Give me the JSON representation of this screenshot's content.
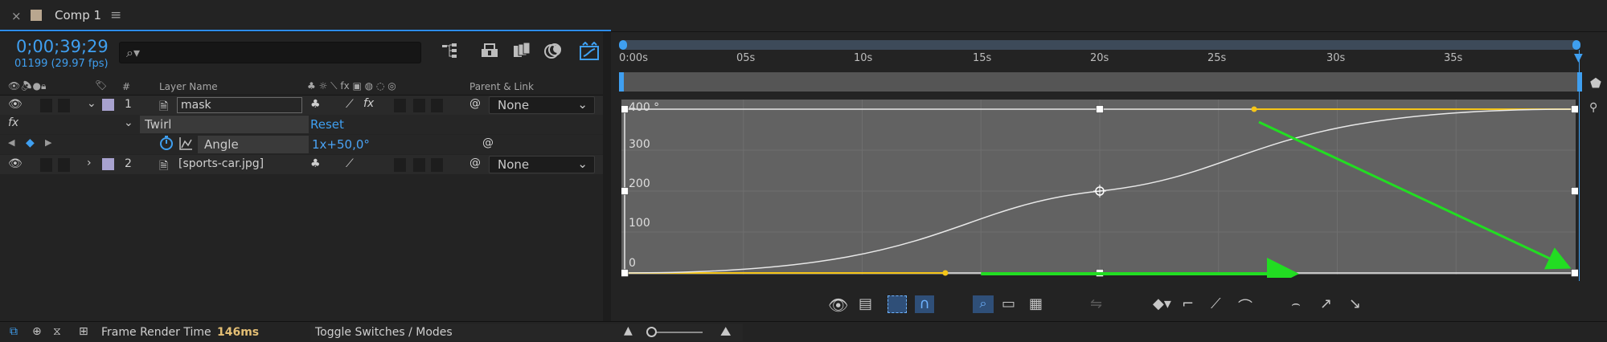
{
  "comp_tab": {
    "close": "×",
    "title": "Comp 1",
    "menu": "≡"
  },
  "timecode": "0;00;39;29",
  "fps": "01199 (29.97 fps)",
  "search": {
    "placeholder": "",
    "icon": "search-icon"
  },
  "layer_header": {
    "number_col": "#",
    "layer_name_col": "Layer Name",
    "parent_col": "Parent & Link"
  },
  "layers": [
    {
      "index": "1",
      "name": "mask",
      "parent": "None"
    },
    {
      "index": "2",
      "name": "[sports-car.jpg]",
      "parent": "None"
    }
  ],
  "effect": {
    "fx_label": "fx",
    "name": "Twirl",
    "reset_label": "Reset",
    "property_name": "Angle",
    "property_value": "1x+50,0°"
  },
  "ruler": {
    "start_label": "0:00s",
    "ticks": [
      "05s",
      "10s",
      "15s",
      "20s",
      "25s",
      "30s",
      "35s"
    ]
  },
  "graph": {
    "y_labels": [
      "400 °",
      "300",
      "200",
      "100",
      "0"
    ]
  },
  "bottom_bar": {
    "frame_render_label": "Frame Render Time",
    "frame_render_value": "146ms",
    "toggle_label": "Toggle Switches / Modes"
  },
  "chart_data": {
    "type": "line",
    "xlabel": "",
    "ylabel": "",
    "x_ticks": [
      "0:00s",
      "05s",
      "10s",
      "15s",
      "20s",
      "25s",
      "30s",
      "35s"
    ],
    "ylim": [
      0,
      400
    ],
    "series": [
      {
        "values": [
          [
            0,
            0
          ],
          [
            20,
            200
          ],
          [
            40,
            400
          ]
        ]
      }
    ]
  },
  "colors": {
    "accent": "#2d8ceb",
    "timecode": "#3f9ff0",
    "layer_label": "#a8a2cf",
    "handle_yellow": "#f5c518",
    "arrow_green": "#22dd22",
    "render_value": "#e3be74"
  }
}
